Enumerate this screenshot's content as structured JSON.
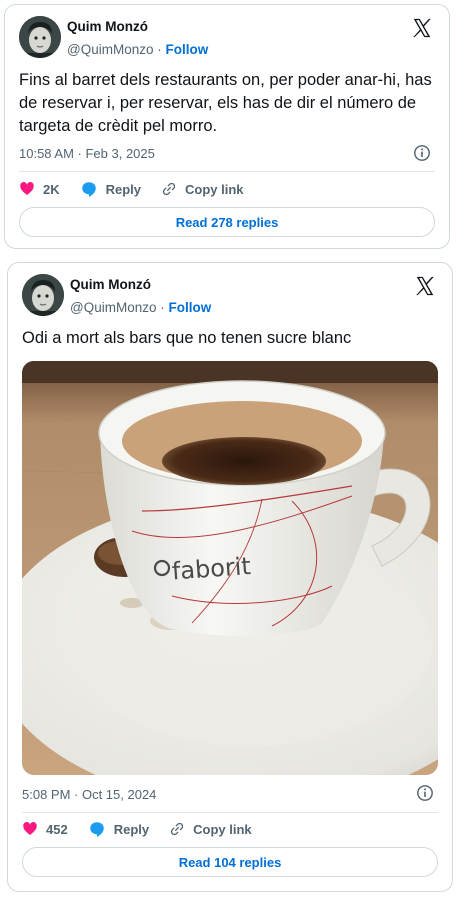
{
  "tweets": [
    {
      "author_name": "Quim Monzó",
      "handle": "@QuimMonzo",
      "follow_label": "Follow",
      "text": "Fins al barret dels restaurants on, per poder anar-hi, has de reservar i, per reservar, els has de dir el número de targeta de crèdit pel morro.",
      "timestamp": "10:58 AM · Feb 3, 2025",
      "likes": "2K",
      "reply_label": "Reply",
      "copy_link_label": "Copy link",
      "replies_button": "Read 278 replies"
    },
    {
      "author_name": "Quim Monzó",
      "handle": "@QuimMonzo",
      "follow_label": "Follow",
      "text": "Odi a mort als bars que no tenen sucre blanc",
      "timestamp": "5:08 PM · Oct 15, 2024",
      "likes": "452",
      "reply_label": "Reply",
      "copy_link_label": "Copy link",
      "replies_button": "Read 104 replies",
      "cup_text": "faborit"
    }
  ],
  "icons": {
    "brand": "x-logo-icon",
    "info": "info-icon",
    "like": "heart-icon",
    "reply": "speech-bubble-icon",
    "copy": "link-icon"
  },
  "colors": {
    "follow": "#006fd6",
    "heart": "#f91880",
    "reply_bubble": "#1d9bf0",
    "text": "#0f1419",
    "muted": "#536471",
    "border": "#cfd9de"
  }
}
